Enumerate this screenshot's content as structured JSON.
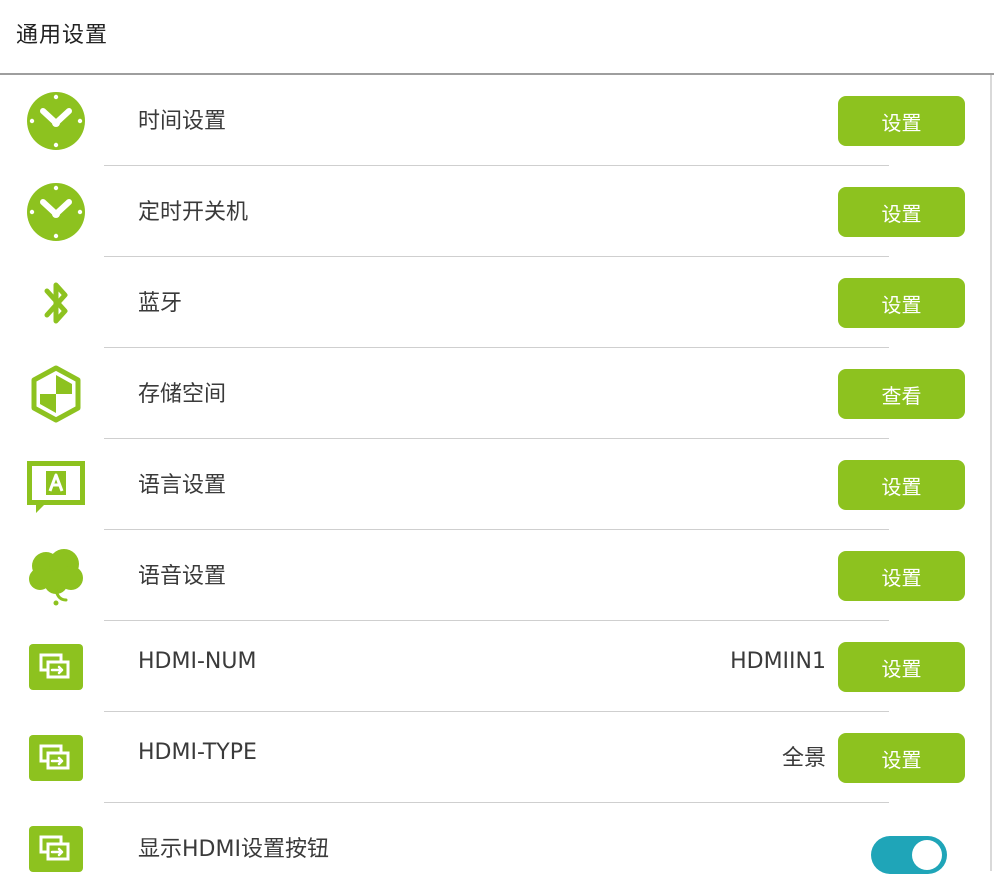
{
  "header": {
    "title": "通用设置"
  },
  "colors": {
    "accent": "#8dc21f",
    "toggle_on": "#1fa5b8"
  },
  "rows": [
    {
      "label": "时间设置",
      "icon": "clock-icon",
      "value": "",
      "button": "设置"
    },
    {
      "label": "定时开关机",
      "icon": "clock-icon",
      "value": "",
      "button": "设置"
    },
    {
      "label": "蓝牙",
      "icon": "bluetooth-icon",
      "value": "",
      "button": "设置"
    },
    {
      "label": "存储空间",
      "icon": "storage-icon",
      "value": "",
      "button": "查看"
    },
    {
      "label": "语言设置",
      "icon": "language-icon",
      "value": "",
      "button": "设置"
    },
    {
      "label": "语音设置",
      "icon": "voice-icon",
      "value": "",
      "button": "设置"
    },
    {
      "label": "HDMI-NUM",
      "icon": "hdmi-icon",
      "value": "HDMIIN1",
      "button": "设置"
    },
    {
      "label": "HDMI-TYPE",
      "icon": "hdmi-icon",
      "value": "全景",
      "button": "设置"
    },
    {
      "label": "显示HDMI设置按钮",
      "icon": "hdmi-icon",
      "toggle": "on"
    }
  ]
}
